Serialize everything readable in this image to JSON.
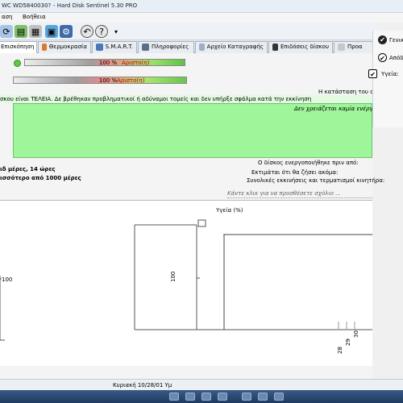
{
  "window": {
    "title_left": "WC WD5840030?",
    "title_right": "- Hard Disk Sentinel 5.30 PRO"
  },
  "menu": {
    "items": [
      "αση",
      "Βοήθεια"
    ]
  },
  "tabs": [
    {
      "label": "Επισκόπηση",
      "active": true
    },
    {
      "label": "Θερμοκρασία",
      "active": false
    },
    {
      "label": "S.M.A.R.T.",
      "active": false
    },
    {
      "label": "Πληροφορίες",
      "active": false
    },
    {
      "label": "Αρχείο Καταγραφής",
      "active": false
    },
    {
      "label": "Επιδόσεις δίσκου",
      "active": false
    },
    {
      "label": "Προα",
      "active": false
    }
  ],
  "right_panel": {
    "general": "Γενικ",
    "performance": "Απόδοση",
    "health": "Υγεία:"
  },
  "performance_bar": {
    "text": "100 %",
    "value": 100,
    "status": "Αριστο(η)"
  },
  "health_bar": {
    "text": "100 %",
    "value": 100,
    "status": "Αριστο(η)"
  },
  "status_area": {
    "heading": "Η κατάσταση του σκληρο",
    "message": "σκου είναι ΤΕΛΕΙΑ. Δε βρέθηκαν προβληματικοί ή αδύναμοι τομείς και δεν υπήρξε σφάλμα κατά την εκκίνηση ",
    "sub_message": "Δεν χρειάζεται καμία ενέργεια.",
    "colors": {
      "panel": "#9ef59a",
      "border": "#6cc46a"
    }
  },
  "power_on": {
    "left_value": "ιδ μέρες, 14 ώρες",
    "left_estimate": "ισσότερο από 1000 μέρες",
    "label_time": "Ο δίσκος ενεργοποιήθηκε πριν από:",
    "label_estimate": "Εκτιμάται ότι θα ζήσει ακόμα:",
    "label_starts": "Συνολικές εκκινήσεις και τερματισμοί κινητήρα:"
  },
  "comment_placeholder": "Κάντε κλικ για να προσθέσετε σχόλιο ...",
  "chart_data": {
    "type": "line",
    "title": "Υγεία (%)",
    "series": [
      {
        "values": [
          100,
          100
        ]
      }
    ],
    "visible_y_ticks": [
      "0",
      "100"
    ],
    "visible_x_ticks": [
      "28",
      "29",
      "30"
    ],
    "grid": false,
    "legend": "none"
  },
  "statusbar": {
    "text": "Κυριακή 10/28/01 Υμ"
  }
}
